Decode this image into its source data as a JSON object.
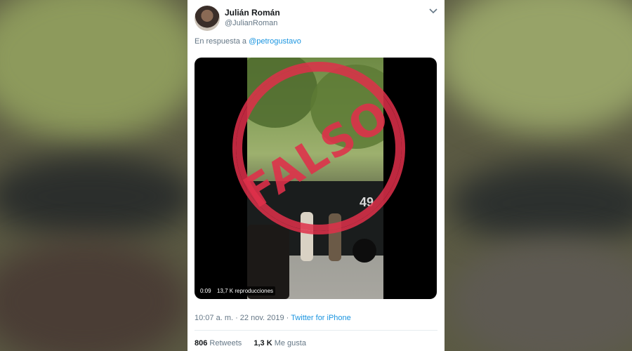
{
  "tweet": {
    "author_name": "Julián Román",
    "author_handle": "@JulianRoman",
    "reply_prefix": "En respuesta a",
    "reply_to": "@petrogustavo",
    "media": {
      "stamp_text": "FALSO",
      "vehicle_number": "49",
      "duration": "0:09",
      "views": "13,7 K reproducciones"
    },
    "timestamp": "10:07 a. m. · 22 nov. 2019 ·",
    "source": "Twitter for iPhone",
    "retweets_count": "806",
    "retweets_label": "Retweets",
    "likes_count": "1,3 K",
    "likes_label": "Me gusta"
  },
  "icons": {
    "more": "chevron-down-icon"
  }
}
